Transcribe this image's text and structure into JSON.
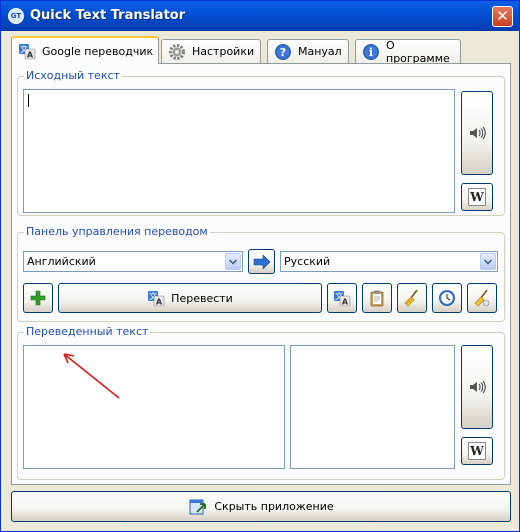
{
  "window": {
    "title": "Quick Text Translator",
    "title_icon": "GT",
    "close": "✕"
  },
  "tabs": [
    {
      "label": "Google переводчик",
      "icon": "translate-icon",
      "active": true
    },
    {
      "label": "Настройки",
      "icon": "gear-icon",
      "active": false
    },
    {
      "label": "Мануал",
      "icon": "help-icon",
      "active": false
    },
    {
      "label": "О программе",
      "icon": "info-icon",
      "active": false
    }
  ],
  "source": {
    "label": "Исходный текст",
    "value": ""
  },
  "controls": {
    "label": "Панель управления переводом",
    "from_language": "Английский",
    "to_language": "Русский",
    "translate_label": "Перевести"
  },
  "result": {
    "label": "Переведенный текст",
    "value": "",
    "alt_value": ""
  },
  "wiki_label": "W",
  "hide_label": "Скрыть приложение",
  "colors": {
    "accent": "#0551d4",
    "group_label": "#1f4fad",
    "tab_highlight": "#ffc83c",
    "add_icon": "#2e9e24"
  }
}
